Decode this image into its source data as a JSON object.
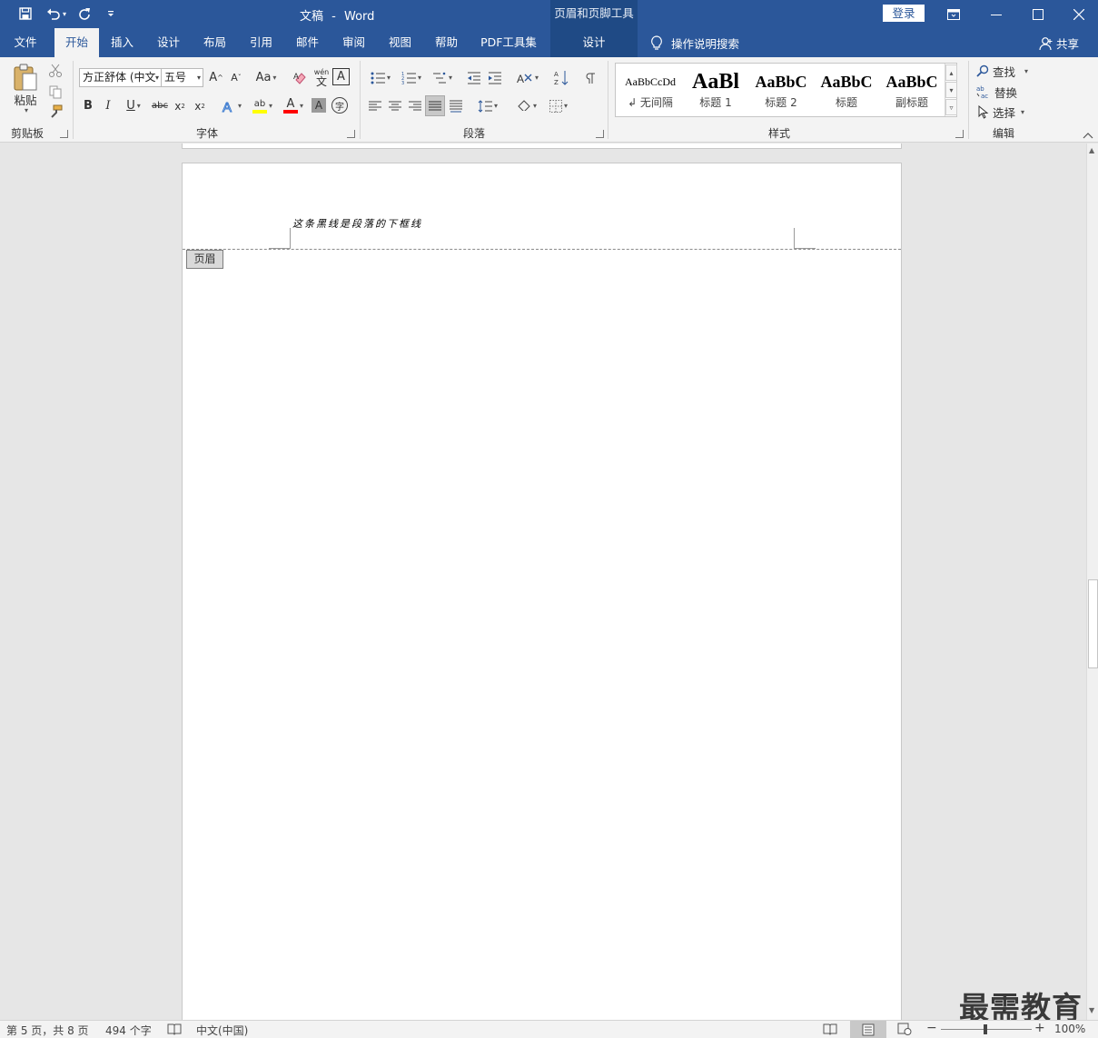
{
  "window": {
    "doc_title": "文稿",
    "title_sep": "-",
    "app_name": "Word",
    "context_tool_title": "页眉和页脚工具",
    "login_label": "登录"
  },
  "tabs": [
    {
      "label": "文件"
    },
    {
      "label": "开始"
    },
    {
      "label": "插入"
    },
    {
      "label": "设计"
    },
    {
      "label": "布局"
    },
    {
      "label": "引用"
    },
    {
      "label": "邮件"
    },
    {
      "label": "审阅"
    },
    {
      "label": "视图"
    },
    {
      "label": "帮助"
    },
    {
      "label": "PDF工具集"
    },
    {
      "label": "设计"
    }
  ],
  "tell_me": "操作说明搜索",
  "share": "共享",
  "ribbon": {
    "clipboard": {
      "paste_label": "粘贴",
      "group_label": "剪贴板"
    },
    "font": {
      "font_name": "方正舒体 (中文",
      "font_size": "五号",
      "aa_label": "Aa",
      "wen_label": "wén",
      "wen_char": "文",
      "group_label": "字体"
    },
    "paragraph": {
      "group_label": "段落"
    },
    "styles": {
      "group_label": "样式",
      "items": [
        {
          "preview": "AaBbCcDd",
          "name": "↲ 无间隔"
        },
        {
          "preview": "AaBl",
          "name": "标题 1"
        },
        {
          "preview": "AaBbC",
          "name": "标题 2"
        },
        {
          "preview": "AaBbC",
          "name": "标题"
        },
        {
          "preview": "AaBbC",
          "name": "副标题"
        }
      ]
    },
    "editing": {
      "find": "查找",
      "replace": "替换",
      "select": "选择",
      "group_label": "编辑"
    }
  },
  "document": {
    "header_text": "这条黑线是段落的下框线",
    "header_tag": "页眉"
  },
  "status": {
    "page": "第 5 页，共 8 页",
    "words": "494 个字",
    "language": "中文(中国)",
    "zoom": "100%",
    "zoom_minus": "−",
    "zoom_plus": "+"
  },
  "watermark": "最需教育",
  "colors": {
    "brand": "#2b579a",
    "highlight": "#ffff00",
    "font_color": "#ff0000"
  }
}
